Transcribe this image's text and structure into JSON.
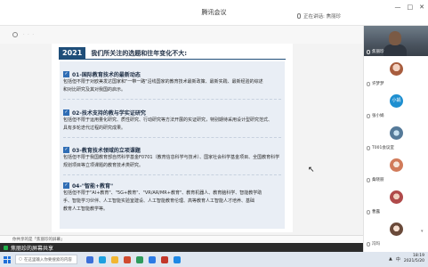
{
  "window": {
    "title": "腾讯会议",
    "speaking_label": "正在讲话: 焦丽珍",
    "controls": [
      "—",
      "□",
      "✕"
    ]
  },
  "slide": {
    "year": "2021",
    "header": "我们所关注的选题和往年变化不大:",
    "sections": [
      {
        "title": "01-国际教育技术的最新动态",
        "lines": [
          "包括但不限于对欧美发达国家和\"一带一路\"沿线国家的教育技术最新政策、最新实践、最新经验的综述",
          "和对比研究及其对我国的启示。"
        ]
      },
      {
        "title": "02-技术支持的教与学实证研究",
        "lines": [
          "包括但不限于运用量化研究、质性研究、行动研究等方法开展的实证研究，特别期待采用设计型研究范式、",
          "具有多轮迭代过程的研究成果。"
        ]
      },
      {
        "title": "03-教育技术领域的立项课题",
        "lines": [
          "包括但不限于我国教育部自然科学基金F0701（教育信息科学与技术）、国家社会科学基金项目、全国教育科学",
          "规划项目等立项课题的教育技术类研究。"
        ]
      },
      {
        "title": "04-\"智能+教育\"",
        "lines": [
          "包括但不限于\"AI+教育\"、\"5G+教育\"、\"VR/AR/MR+教育\"、教育机器人、教育脑科学、智能教学助",
          "手、智能学习伙伴、人工智能实验室建设、人工智能教育伦理、高等教育人工智能人才培养、基础",
          "教育人工智能教学等。"
        ]
      }
    ]
  },
  "share": {
    "strip_text": "你共享的是「焦丽珍的屏幕」",
    "banner_text": "焦丽珍的屏幕共享"
  },
  "taskbar": {
    "search_placeholder": "在这里输入你要搜索的内容",
    "tray_lang": "中",
    "time": "18:19",
    "date": "2021/5/20"
  },
  "participants": [
    {
      "name": "焦丽珍",
      "kind": "video"
    },
    {
      "name": "许梦梦",
      "kind": "avatar",
      "style": "pic-a"
    },
    {
      "name": "张小娟",
      "kind": "avatar-text",
      "initials": "小娟"
    },
    {
      "name": "T001会议室",
      "kind": "avatar",
      "style": "pic-c"
    },
    {
      "name": "桑晓丽",
      "kind": "avatar",
      "style": "pic-d"
    },
    {
      "name": "曹露",
      "kind": "avatar",
      "style": "pic-e"
    },
    {
      "name": "冯玛",
      "kind": "avatar",
      "style": "pic-f"
    }
  ],
  "colors": {
    "accent": "#1f4e79",
    "check": "#2f6db5",
    "slide_body": "#e9eef5",
    "share_dot": "#22b14c"
  }
}
